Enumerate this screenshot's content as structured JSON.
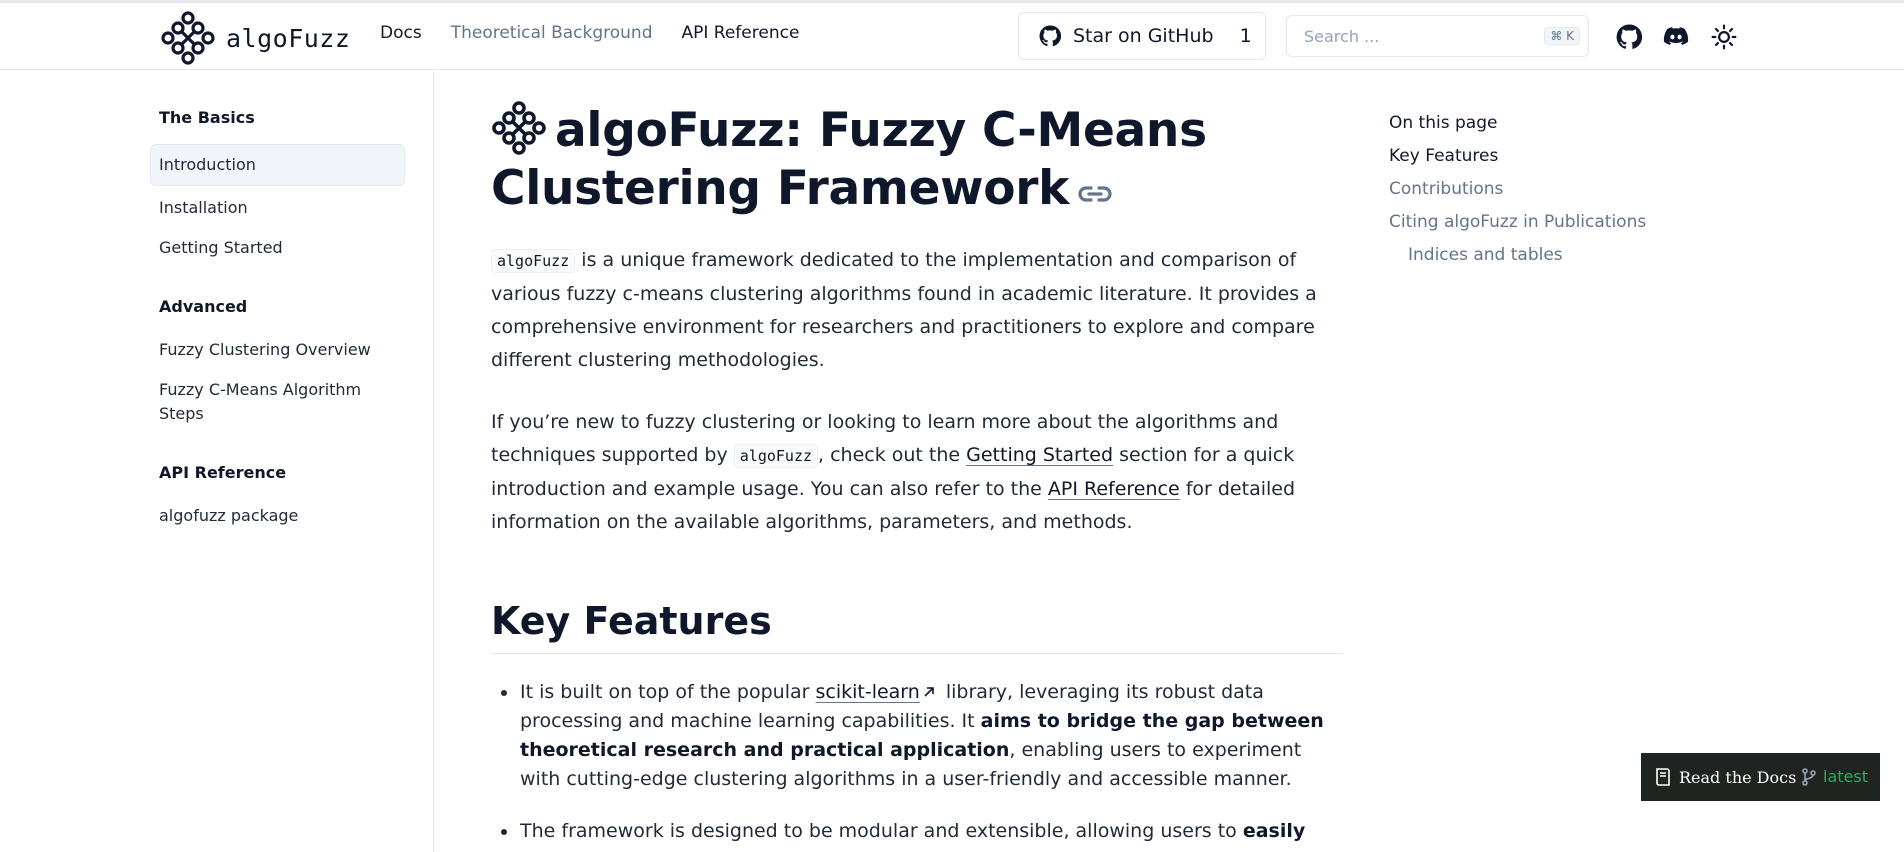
{
  "header": {
    "logo_text": "algoFuzz",
    "nav": [
      {
        "label": "Docs"
      },
      {
        "label": "Theoretical Background"
      },
      {
        "label": "API Reference"
      }
    ],
    "github_button": {
      "label": "Star on GitHub",
      "count": "1"
    },
    "search": {
      "placeholder": "Search ...",
      "shortcut": "⌘ K"
    }
  },
  "sidebar": {
    "sections": [
      {
        "title": "The Basics",
        "items": [
          "Introduction",
          "Installation",
          "Getting Started"
        ]
      },
      {
        "title": "Advanced",
        "items": [
          "Fuzzy Clustering Overview",
          "Fuzzy C-Means Algorithm Steps"
        ]
      },
      {
        "title": "API Reference",
        "items": [
          "algofuzz package"
        ]
      }
    ]
  },
  "main": {
    "title": "algoFuzz: Fuzzy C-Means Clustering Framework",
    "intro": {
      "code": "algoFuzz",
      "text": " is a unique framework dedicated to the implementation and comparison of various fuzzy c-means clustering algorithms found in academic literature. It provides a comprehensive environment for researchers and practitioners to explore and compare different clustering methodologies."
    },
    "para2": {
      "part1": "If you’re new to fuzzy clustering or looking to learn more about the algorithms and techniques supported by ",
      "code": "algoFuzz",
      "part2": ", check out the ",
      "link1": "Getting Started",
      "part3": " section for a quick introduction and example usage. You can also refer to the ",
      "link2": "API Reference",
      "part4": " for detailed information on the available algorithms, parameters, and methods."
    },
    "key_features_heading": "Key Features",
    "features": [
      {
        "part1": "It is built on top of the popular ",
        "link": "scikit-learn",
        "part2": " library, leveraging its robust data processing and machine learning capabilities. It ",
        "bold": "aims to bridge the gap between theoretical research and practical application",
        "part3": ", enabling users to experiment with cutting-edge clustering algorithms in a user-friendly and accessible manner."
      },
      {
        "part1": "The framework is designed to be modular and extensible, allowing users to ",
        "bold": "easily"
      }
    ]
  },
  "toc": {
    "heading": "On this page",
    "items": [
      "Key Features",
      "Contributions",
      "Citing algoFuzz in Publications",
      "Indices and tables"
    ]
  },
  "rtd": {
    "label": "Read the Docs",
    "version": "latest"
  },
  "colors": {
    "accent": "#0f172a",
    "muted": "#64748b",
    "rtd_bg": "#1f2421",
    "rtd_version": "#27ae60"
  }
}
